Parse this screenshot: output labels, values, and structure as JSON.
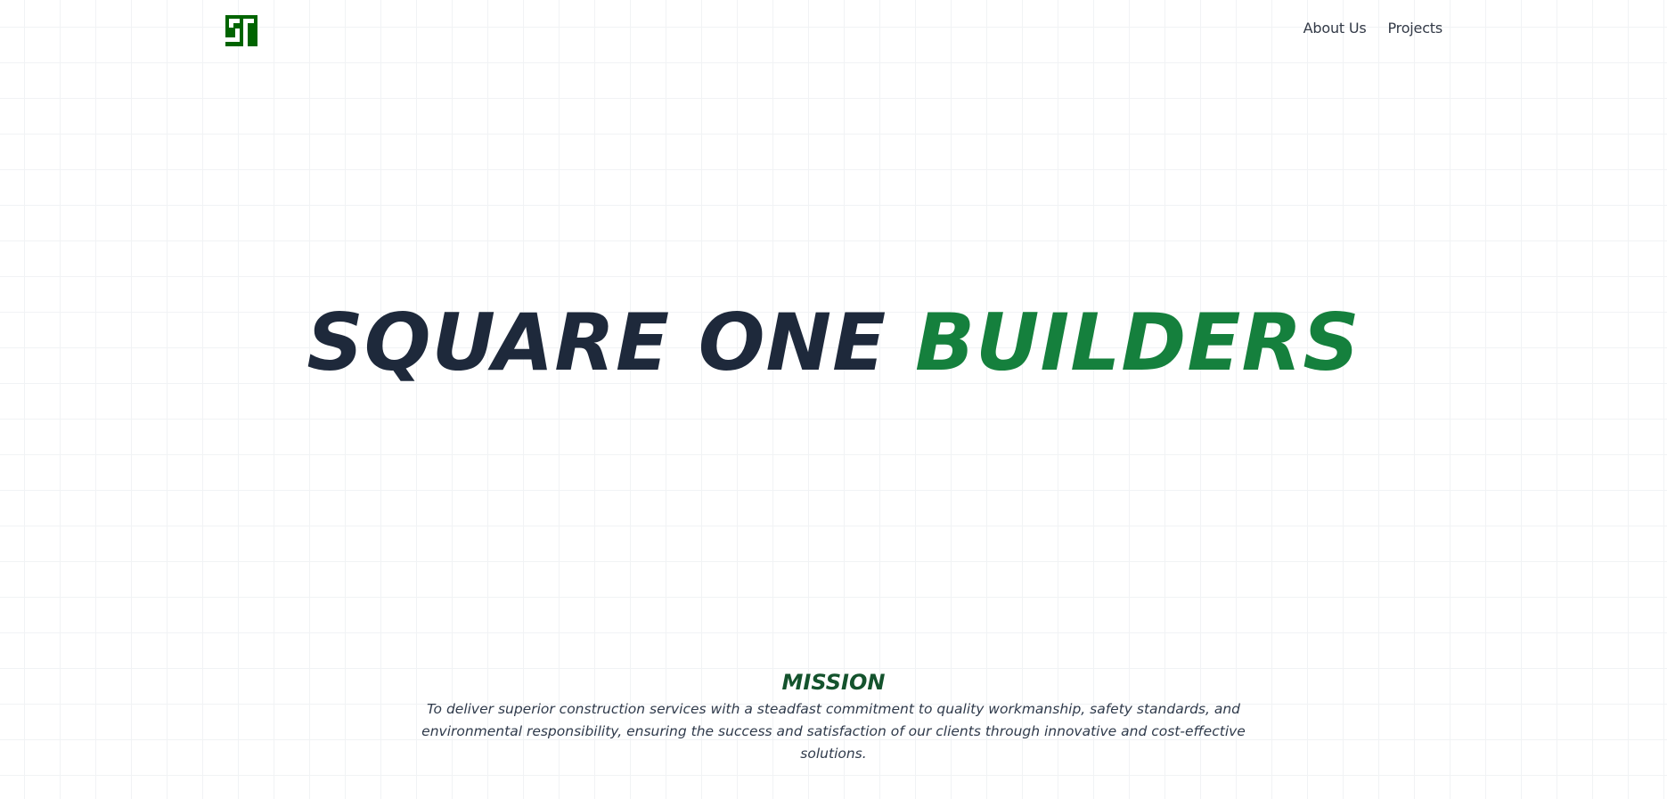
{
  "logo": {
    "icon": "square-one-logo",
    "color": "#006400"
  },
  "nav": {
    "items": [
      {
        "label": "About Us"
      },
      {
        "label": "Projects"
      }
    ]
  },
  "hero": {
    "title_part1": "SQUARE ONE",
    "title_part2": "BUILDERS",
    "colors": {
      "dark": "#1e293b",
      "accent": "#15803d"
    }
  },
  "mission": {
    "title": "MISSION",
    "text": "To deliver superior construction services with a steadfast commitment to quality workmanship, safety standards, and environmental responsibility, ensuring the success and satisfaction of our clients through innovative and cost-effective solutions."
  }
}
